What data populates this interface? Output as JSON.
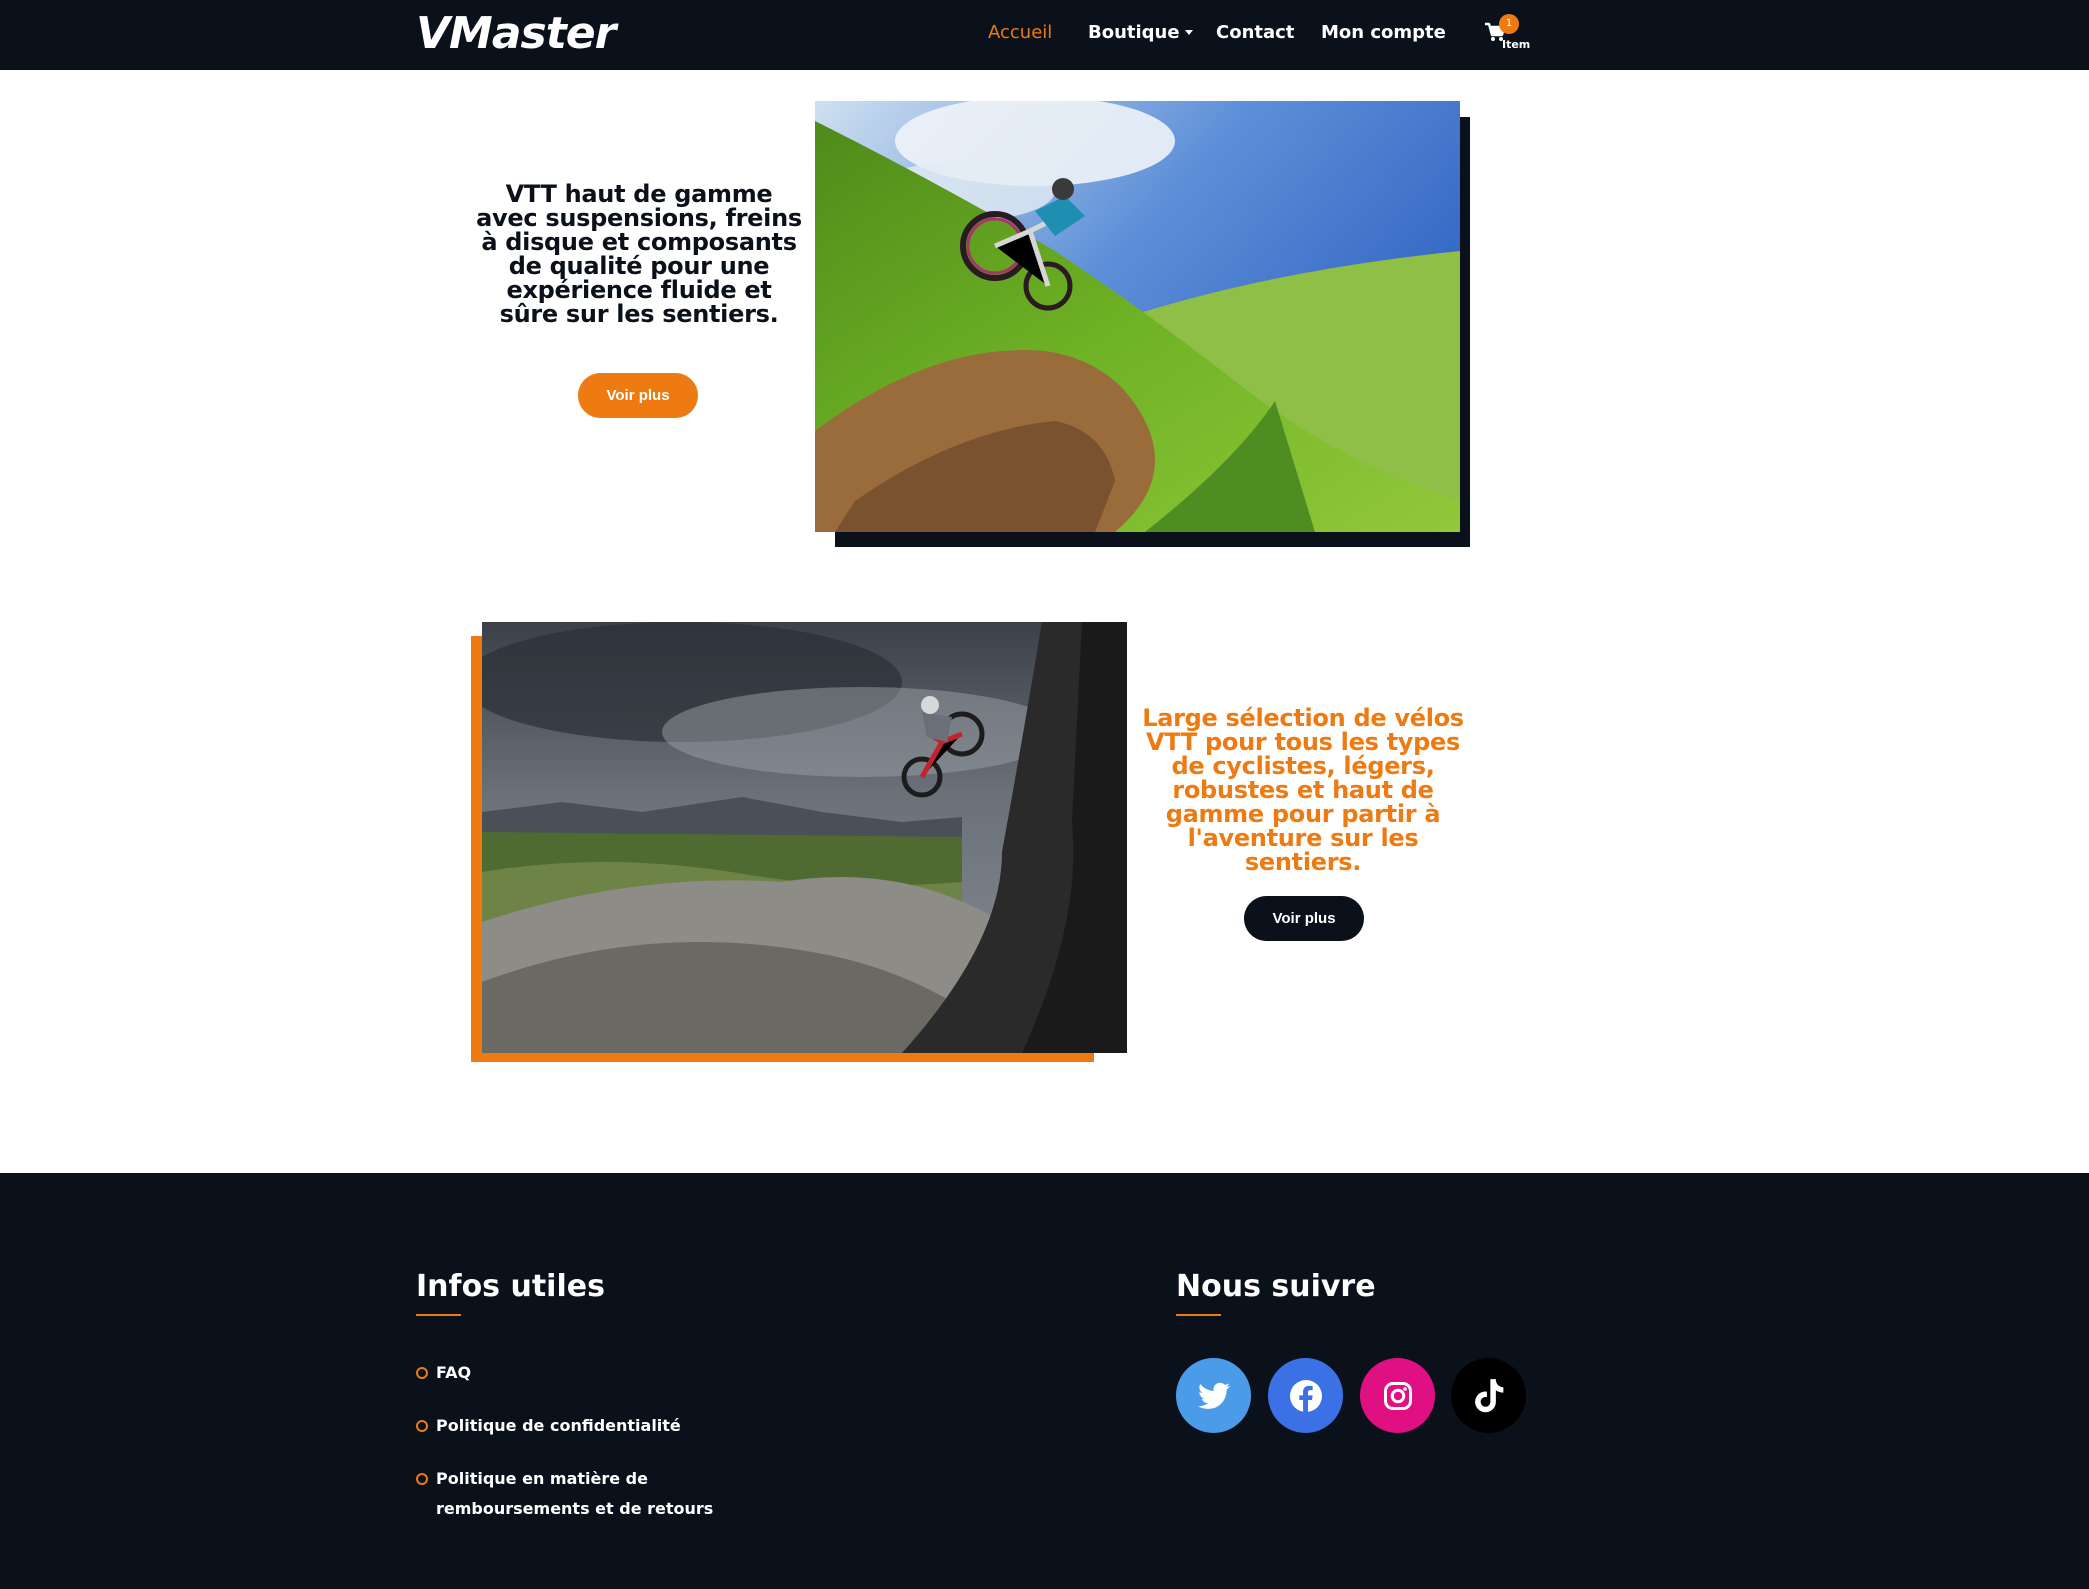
{
  "navbar": {
    "brand": "VMaster",
    "items": [
      {
        "label": "Accueil",
        "active": true
      },
      {
        "label": "Boutique",
        "dropdown": true
      },
      {
        "label": "Contact"
      },
      {
        "label": "Mon compte"
      }
    ],
    "cart": {
      "count": "1",
      "label": "Item",
      "icon": "cart-icon"
    }
  },
  "features": [
    {
      "text": "VTT haut de gamme avec suspensions, freins à disque et composants de qualité pour une expérience fluide et sûre sur les sentiers.",
      "button": "Voir plus"
    },
    {
      "text": "Large sélection de vélos VTT pour tous les types de cyclistes, légers, robustes et haut de gamme pour partir à l'aventure sur les sentiers.",
      "button": "Voir plus"
    }
  ],
  "footer": {
    "infos": {
      "heading": "Infos utiles",
      "links": [
        "FAQ",
        "Politique de confidentialité",
        "Politique en matière de remboursements et de retours"
      ]
    },
    "follow": {
      "heading": "Nous suivre",
      "networks": [
        {
          "name": "twitter-icon",
          "color": "#4b9ce8"
        },
        {
          "name": "facebook-icon",
          "color": "#3c71e6"
        },
        {
          "name": "instagram-icon",
          "color": "#e00f82"
        },
        {
          "name": "tiktok-icon",
          "color": "#000000"
        }
      ]
    }
  },
  "colors": {
    "accent": "#ee7a12",
    "dark": "#0b111a"
  }
}
